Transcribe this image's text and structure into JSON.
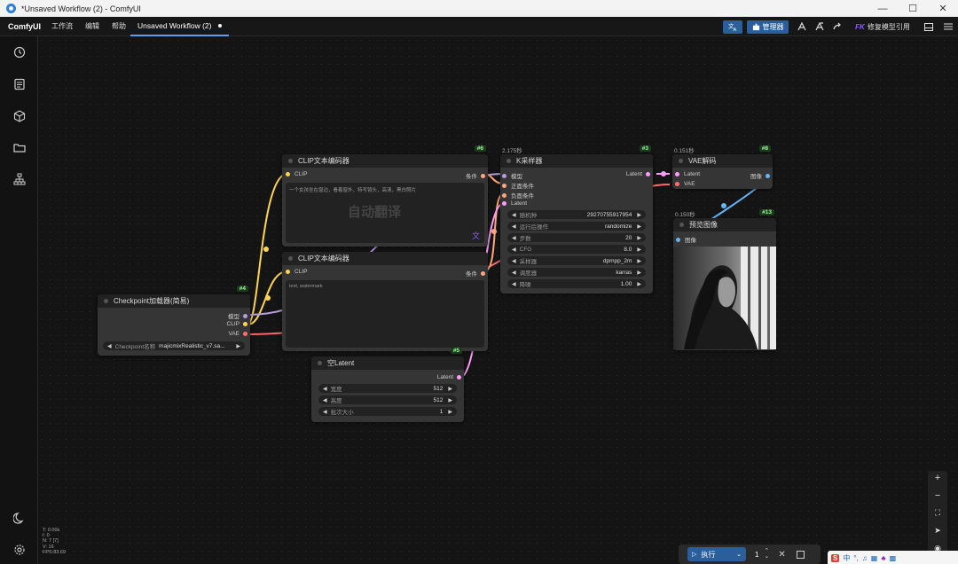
{
  "window": {
    "title": "*Unsaved Workflow (2) - ComfyUI",
    "controls": [
      "—",
      "☐",
      "✕"
    ]
  },
  "menubar": {
    "brand": "ComfyUI",
    "menus": [
      "工作流",
      "编辑",
      "帮助"
    ],
    "active_tab": "Unsaved Workflow (2)",
    "manager_label": "管理器",
    "fix_model_prefix": "FK",
    "fix_model_label": "修复模型引用",
    "accent": "#2b5f9c"
  },
  "sidebar": {
    "icons": [
      "history-icon",
      "queue-icon",
      "model-library-icon",
      "workflows-icon",
      "node-library-icon",
      "theme-toggle-icon",
      "settings-icon"
    ]
  },
  "nodes": {
    "clip_pos": {
      "badge": "#6",
      "title": "CLIP文本编码器",
      "input": "CLIP",
      "output": "条件",
      "text": "一个女孩坐在窗边，看着窗外，特写镜头，高清，黑白照片",
      "overlay": "自动翻译"
    },
    "clip_neg": {
      "title": "CLIP文本编码器",
      "input": "CLIP",
      "output": "条件",
      "text": "text, watermark"
    },
    "checkpoint": {
      "badge": "#4",
      "title": "Checkpoint加载器(简易)",
      "outputs": [
        "模型",
        "CLIP",
        "VAE"
      ],
      "widget_label": "Checkpoint名称",
      "widget_value": "majicmixRealistic_v7.sa..."
    },
    "latent": {
      "badge": "#5",
      "title": "空Latent",
      "output": "Latent",
      "widgets": [
        {
          "label": "宽度",
          "value": "512"
        },
        {
          "label": "高度",
          "value": "512"
        },
        {
          "label": "批次大小",
          "value": "1"
        }
      ]
    },
    "ksampler": {
      "badge": "#3",
      "timing": "2.175秒",
      "title": "K采样器",
      "inputs": [
        "模型",
        "正面条件",
        "负面条件",
        "Latent"
      ],
      "output": "Latent",
      "widgets": [
        {
          "label": "随机种",
          "value": "292707559179​54"
        },
        {
          "label": "运行后操作",
          "value": "randomize"
        },
        {
          "label": "步数",
          "value": "20"
        },
        {
          "label": "CFG",
          "value": "8.0"
        },
        {
          "label": "采样器",
          "value": "dpmpp_2m"
        },
        {
          "label": "调度器",
          "value": "karras"
        },
        {
          "label": "降噪",
          "value": "1.00"
        }
      ]
    },
    "vae": {
      "badge": "#8",
      "timing": "0.151秒",
      "title": "VAE解码",
      "inputs": [
        "Latent",
        "VAE"
      ],
      "output": "图像"
    },
    "preview": {
      "badge": "#13",
      "timing": "0.150秒",
      "title": "预览图像",
      "input": "图像"
    }
  },
  "stats": [
    "T: 0.00s",
    "I: 0",
    "N: 7 [7]",
    "V: 16",
    "FPS:83.69"
  ],
  "runbar": {
    "run_label": "执行",
    "count": "1"
  },
  "colors": {
    "model": "#b39ddb",
    "clip": "#ffd54f",
    "vae": "#ff6e6e",
    "conditioning": "#ffa77a",
    "latent": "#ff9cf9",
    "image": "#64b5f6"
  }
}
